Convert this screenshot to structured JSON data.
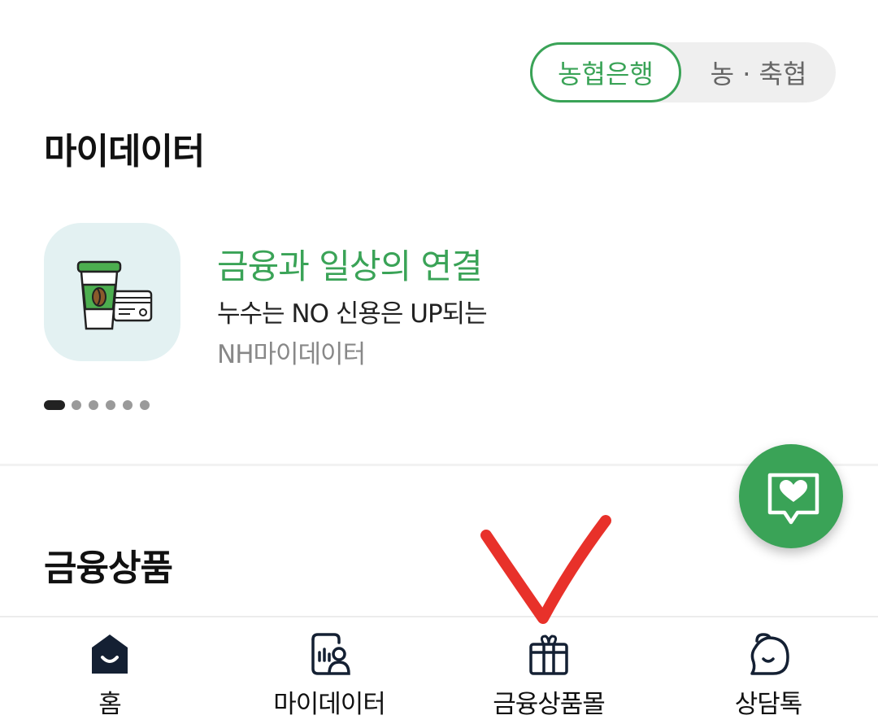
{
  "toggle": {
    "active_label": "농협은행",
    "inactive_label": "농 · 축협"
  },
  "mydata": {
    "title": "마이데이터",
    "banner": {
      "icon": "coffee-card-icon",
      "headline": "금융과 일상의 연결",
      "subline": "누수는 NO 신용은 UP되는",
      "brand": "NH마이데이터"
    },
    "pagination": {
      "count": 6,
      "active_index": 0
    }
  },
  "products": {
    "title": "금융상품"
  },
  "fab": {
    "icon": "chat-heart-icon"
  },
  "nav": {
    "items": [
      {
        "label": "홈",
        "icon": "home-icon"
      },
      {
        "label": "마이데이터",
        "icon": "mydata-icon"
      },
      {
        "label": "금융상품몰",
        "icon": "gift-icon"
      },
      {
        "label": "상담톡",
        "icon": "chat-bubble-icon"
      }
    ]
  },
  "colors": {
    "accent": "#3aa357",
    "annotation": "#e8312a",
    "icon_bg": "#e3f1f2"
  }
}
